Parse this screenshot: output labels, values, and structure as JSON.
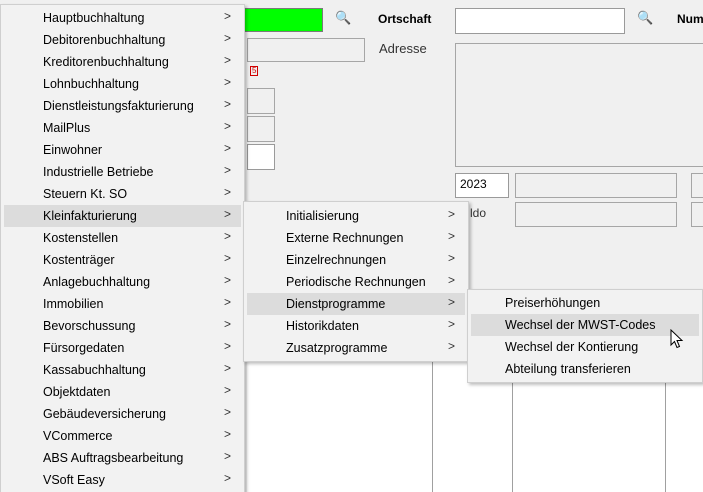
{
  "form": {
    "ortschaft_label": "Ortschaft",
    "num_label": "Num",
    "adresse_label": "Adresse",
    "year_value": "2023",
    "saldo_label": "ldo",
    "red_mark": "5"
  },
  "menu1": {
    "items": [
      {
        "label": "Hauptbuchhaltung",
        "arrow": ">"
      },
      {
        "label": "Debitorenbuchhaltung",
        "arrow": ">"
      },
      {
        "label": "Kreditorenbuchhaltung",
        "arrow": ">"
      },
      {
        "label": "Lohnbuchhaltung",
        "arrow": ">"
      },
      {
        "label": "Dienstleistungsfakturierung",
        "arrow": ">"
      },
      {
        "label": "MailPlus",
        "arrow": ">"
      },
      {
        "label": "Einwohner",
        "arrow": ">"
      },
      {
        "label": "Industrielle Betriebe",
        "arrow": ">"
      },
      {
        "label": "Steuern Kt. SO",
        "arrow": ">"
      },
      {
        "label": "Kleinfakturierung",
        "arrow": ">"
      },
      {
        "label": "Kostenstellen",
        "arrow": ">"
      },
      {
        "label": "Kostenträger",
        "arrow": ">"
      },
      {
        "label": "Anlagebuchhaltung",
        "arrow": ">"
      },
      {
        "label": "Immobilien",
        "arrow": ">"
      },
      {
        "label": "Bevorschussung",
        "arrow": ">"
      },
      {
        "label": "Fürsorgedaten",
        "arrow": ">"
      },
      {
        "label": "Kassabuchhaltung",
        "arrow": ">"
      },
      {
        "label": "Objektdaten",
        "arrow": ">"
      },
      {
        "label": "Gebäudeversicherung",
        "arrow": ">"
      },
      {
        "label": "VCommerce",
        "arrow": ">"
      },
      {
        "label": "ABS Auftragsbearbeitung",
        "arrow": ">"
      },
      {
        "label": "VSoft Easy",
        "arrow": ">"
      }
    ]
  },
  "menu2": {
    "items": [
      {
        "label": "Initialisierung",
        "arrow": ">"
      },
      {
        "label": "Externe Rechnungen",
        "arrow": ">"
      },
      {
        "label": "Einzelrechnungen",
        "arrow": ">"
      },
      {
        "label": "Periodische Rechnungen",
        "arrow": ">"
      },
      {
        "label": "Dienstprogramme",
        "arrow": ">"
      },
      {
        "label": "Historikdaten",
        "arrow": ">"
      },
      {
        "label": "Zusatzprogramme",
        "arrow": ">"
      }
    ]
  },
  "menu3": {
    "items": [
      {
        "label": "Preiserhöhungen"
      },
      {
        "label": "Wechsel der MWST-Codes"
      },
      {
        "label": "Wechsel der Kontierung"
      },
      {
        "label": "Abteilung transferieren"
      }
    ]
  }
}
